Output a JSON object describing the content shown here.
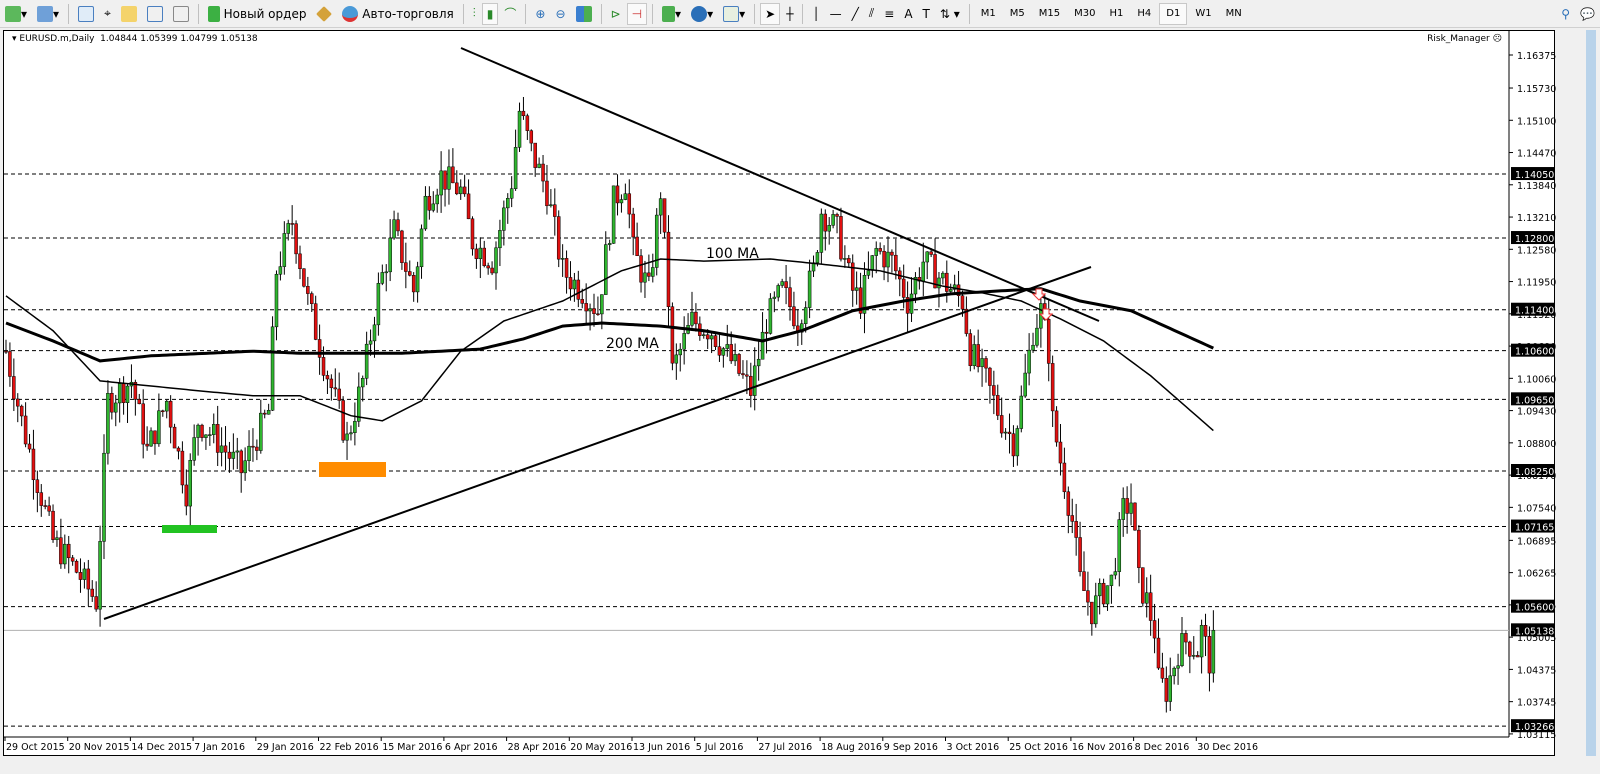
{
  "toolbar": {
    "new_order": "Новый ордер",
    "auto_trading": "Авто-торговля",
    "timeframes": [
      "M1",
      "M5",
      "M15",
      "M30",
      "H1",
      "H4",
      "D1",
      "W1",
      "MN"
    ],
    "active_timeframe": "D1"
  },
  "chart": {
    "title": "EURUSD.m,Daily",
    "ohlc": "1.04844 1.05399 1.04799 1.05138",
    "indicator": "Risk_Manager",
    "ma100_label": "100 MA",
    "ma200_label": "200 MA",
    "current_price": "1.05138"
  },
  "chart_data": {
    "type": "candlestick",
    "symbol": "EURUSD.m",
    "timeframe": "Daily",
    "ylim": [
      1.03115,
      1.16375
    ],
    "bars": 309,
    "price_ticks": [
      "1.16375",
      "1.15730",
      "1.15100",
      "1.14470",
      "1.13840",
      "1.13210",
      "1.12580",
      "1.11950",
      "1.11320",
      "1.10690",
      "1.10060",
      "1.09430",
      "1.08800",
      "1.08170",
      "1.07540",
      "1.06895",
      "1.06265",
      "1.05635",
      "1.05005",
      "1.04375",
      "1.03745",
      "1.03115"
    ],
    "levels": [
      "1.14050",
      "1.12800",
      "1.11400",
      "1.10600",
      "1.09650",
      "1.08250",
      "1.07165",
      "1.05600",
      "1.03266"
    ],
    "date_ticks": [
      "29 Oct 2015",
      "20 Nov 2015",
      "14 Dec 2015",
      "7 Jan 2016",
      "29 Jan 2016",
      "22 Feb 2016",
      "15 Mar 2016",
      "6 Apr 2016",
      "28 Apr 2016",
      "20 May 2016",
      "13 Jun 2016",
      "5 Jul 2016",
      "27 Jul 2016",
      "18 Aug 2016",
      "9 Sep 2016",
      "3 Oct 2016",
      "25 Oct 2016",
      "16 Nov 2016",
      "8 Dec 2016",
      "30 Dec 2016"
    ],
    "close_path": [
      [
        0,
        1.1059
      ],
      [
        4,
        1.0923
      ],
      [
        12,
        1.0688
      ],
      [
        18,
        1.063
      ],
      [
        23,
        1.0571
      ],
      [
        26,
        1.0962
      ],
      [
        32,
        1.1001
      ],
      [
        36,
        1.0864
      ],
      [
        41,
        1.0962
      ],
      [
        46,
        1.0786
      ],
      [
        49,
        1.0923
      ],
      [
        54,
        1.0884
      ],
      [
        60,
        1.0825
      ],
      [
        67,
        1.0942
      ],
      [
        69,
        1.1216
      ],
      [
        73,
        1.1313
      ],
      [
        77,
        1.1157
      ],
      [
        81,
        1.104
      ],
      [
        87,
        1.0884
      ],
      [
        91,
        1.1001
      ],
      [
        95,
        1.1177
      ],
      [
        99,
        1.1294
      ],
      [
        104,
        1.1177
      ],
      [
        107,
        1.1352
      ],
      [
        111,
        1.1401
      ],
      [
        116,
        1.1372
      ],
      [
        119,
        1.1274
      ],
      [
        124,
        1.1235
      ],
      [
        129,
        1.1391
      ],
      [
        131,
        1.1528
      ],
      [
        134,
        1.145
      ],
      [
        138,
        1.1372
      ],
      [
        142,
        1.1216
      ],
      [
        147,
        1.1177
      ],
      [
        151,
        1.1138
      ],
      [
        155,
        1.1352
      ],
      [
        158,
        1.1391
      ],
      [
        160,
        1.1255
      ],
      [
        164,
        1.1177
      ],
      [
        167,
        1.1372
      ],
      [
        169,
        1.1157
      ],
      [
        170,
        1.102
      ],
      [
        175,
        1.1118
      ],
      [
        180,
        1.1099
      ],
      [
        185,
        1.104
      ],
      [
        190,
        1.0981
      ],
      [
        194,
        1.1118
      ],
      [
        198,
        1.1177
      ],
      [
        202,
        1.1118
      ],
      [
        206,
        1.1216
      ],
      [
        208,
        1.1333
      ],
      [
        212,
        1.1294
      ],
      [
        216,
        1.1177
      ],
      [
        218,
        1.1157
      ],
      [
        222,
        1.1255
      ],
      [
        226,
        1.1235
      ],
      [
        230,
        1.1157
      ],
      [
        234,
        1.1235
      ],
      [
        239,
        1.1196
      ],
      [
        244,
        1.1157
      ],
      [
        246,
        1.1059
      ],
      [
        250,
        1.1001
      ],
      [
        254,
        1.0923
      ],
      [
        257,
        1.0884
      ],
      [
        259,
        1.0962
      ],
      [
        262,
        1.1099
      ],
      [
        264,
        1.1138
      ],
      [
        266,
        1.1059
      ],
      [
        267,
        1.0923
      ],
      [
        269,
        1.0845
      ],
      [
        272,
        1.0728
      ],
      [
        274,
        1.061
      ],
      [
        277,
        1.0552
      ],
      [
        280,
        1.0591
      ],
      [
        282,
        1.061
      ],
      [
        285,
        1.0747
      ],
      [
        287,
        1.0767
      ],
      [
        289,
        1.061
      ],
      [
        291,
        1.0571
      ],
      [
        293,
        1.0513
      ],
      [
        294,
        1.0415
      ],
      [
        296,
        1.0396
      ],
      [
        299,
        1.0474
      ],
      [
        301,
        1.0493
      ],
      [
        304,
        1.0474
      ],
      [
        305,
        1.0513
      ],
      [
        307,
        1.0454
      ],
      [
        308,
        1.05138
      ]
    ],
    "ma100_path": [
      [
        0,
        1.1167
      ],
      [
        12,
        1.1099
      ],
      [
        24,
        1.1001
      ],
      [
        37,
        1.0991
      ],
      [
        50,
        1.0981
      ],
      [
        63,
        1.0972
      ],
      [
        75,
        1.0972
      ],
      [
        88,
        1.0933
      ],
      [
        96,
        1.0923
      ],
      [
        106,
        1.0962
      ],
      [
        116,
        1.1059
      ],
      [
        127,
        1.1118
      ],
      [
        142,
        1.1157
      ],
      [
        157,
        1.1216
      ],
      [
        167,
        1.1239
      ],
      [
        178,
        1.1235
      ],
      [
        195,
        1.1239
      ],
      [
        208,
        1.1229
      ],
      [
        223,
        1.1216
      ],
      [
        239,
        1.1186
      ],
      [
        249,
        1.1173
      ],
      [
        259,
        1.1157
      ],
      [
        269,
        1.1122
      ],
      [
        280,
        1.1079
      ],
      [
        292,
        1.1011
      ],
      [
        308,
        1.0904
      ]
    ],
    "ma200_path": [
      [
        0,
        1.1114
      ],
      [
        12,
        1.1079
      ],
      [
        24,
        1.104
      ],
      [
        37,
        1.105
      ],
      [
        63,
        1.1059
      ],
      [
        75,
        1.1055
      ],
      [
        101,
        1.1055
      ],
      [
        121,
        1.1063
      ],
      [
        132,
        1.1083
      ],
      [
        142,
        1.1108
      ],
      [
        152,
        1.1114
      ],
      [
        167,
        1.1108
      ],
      [
        178,
        1.1099
      ],
      [
        193,
        1.1079
      ],
      [
        203,
        1.1099
      ],
      [
        216,
        1.1138
      ],
      [
        229,
        1.1157
      ],
      [
        241,
        1.1171
      ],
      [
        254,
        1.1177
      ],
      [
        264,
        1.1181
      ],
      [
        274,
        1.1157
      ],
      [
        287,
        1.1138
      ],
      [
        308,
        1.1065
      ]
    ]
  }
}
